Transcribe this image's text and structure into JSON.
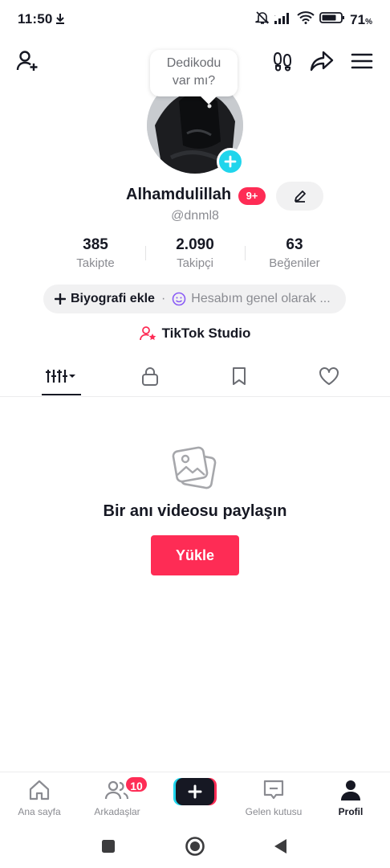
{
  "status_bar": {
    "time": "11:50",
    "battery_percent": "71",
    "battery_unit": "%",
    "icons": [
      "download-icon",
      "bell-muted-icon",
      "signal-icon",
      "wifi-icon",
      "battery-icon"
    ]
  },
  "top_bar": {
    "icons": [
      "add-friend-icon",
      "footprints-icon",
      "share-icon",
      "menu-icon"
    ]
  },
  "bubble": {
    "line1": "Dedikodu",
    "line2": "var mı?"
  },
  "profile": {
    "name": "Alhamdulillah",
    "name_badge": "9+",
    "handle": "@dnml8"
  },
  "stats": [
    {
      "value": "385",
      "label": "Takipte"
    },
    {
      "value": "2.090",
      "label": "Takipçi"
    },
    {
      "value": "63",
      "label": "Beğeniler"
    }
  ],
  "bio": {
    "add_label": "Biyografi ekle",
    "separator": "·",
    "status_text": "Hesabım genel olarak ..."
  },
  "studio": {
    "label": "TikTok Studio"
  },
  "tabs": [
    "videos-grid-tab",
    "private-tab",
    "saved-tab",
    "liked-tab"
  ],
  "empty_state": {
    "title": "Bir anı videosu paylaşın",
    "button": "Yükle"
  },
  "bottom_nav": {
    "home": "Ana sayfa",
    "friends": "Arkadaşlar",
    "friends_badge": "10",
    "inbox": "Gelen kutusu",
    "profile": "Profil"
  },
  "colors": {
    "brand_red": "#fe2c55",
    "brand_cyan": "#20d5ec",
    "text_primary": "#161823",
    "text_secondary": "#8a8b91"
  }
}
